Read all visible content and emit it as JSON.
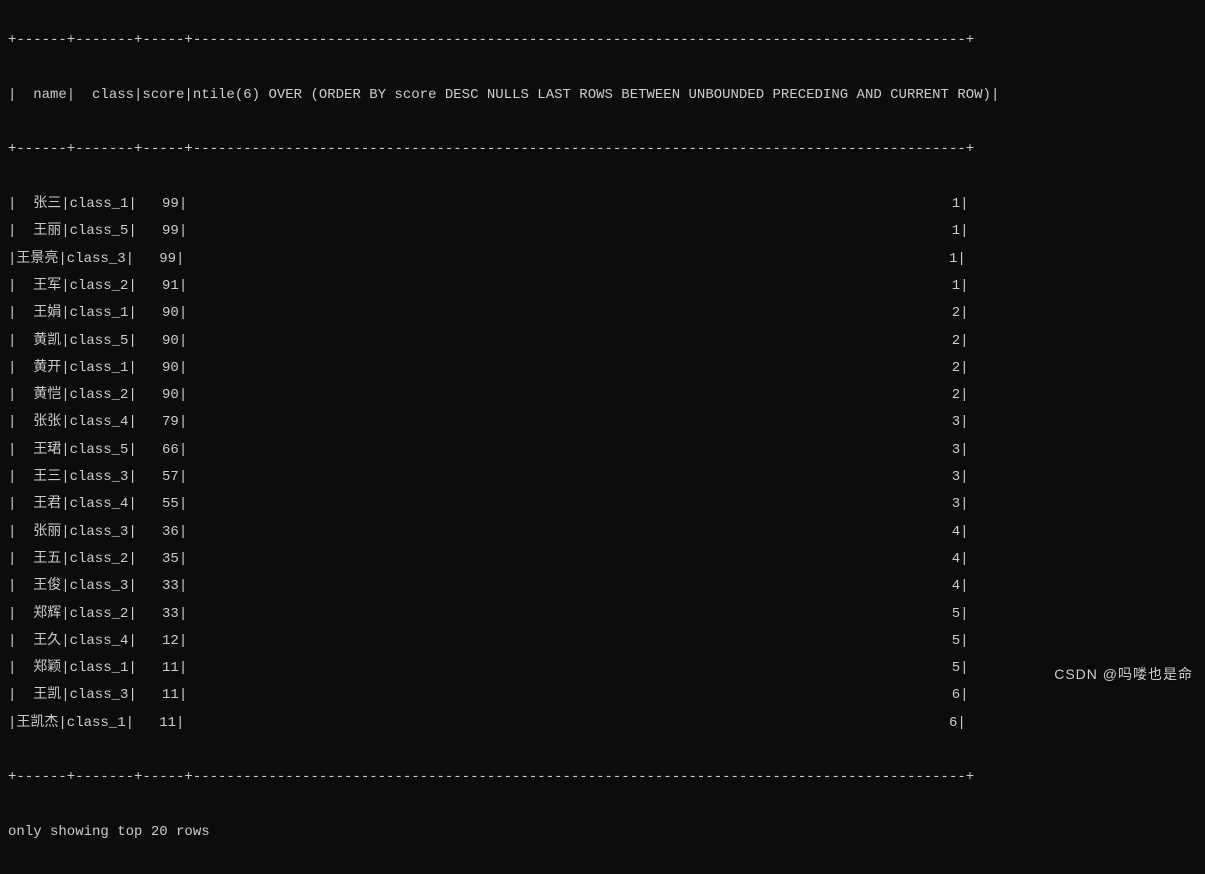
{
  "columns": {
    "name": "name",
    "class": "class",
    "score": "score",
    "ntile": "ntile(6) OVER (ORDER BY score DESC NULLS LAST ROWS BETWEEN UNBOUNDED PRECEDING AND CURRENT ROW)"
  },
  "col_widths": {
    "name": 6,
    "class": 7,
    "score": 5,
    "ntile": 92
  },
  "chart_data": {
    "type": "table",
    "title": "ntile(6) window query result (top 20 rows)",
    "columns": [
      "name",
      "class",
      "score",
      "ntile"
    ],
    "rows": [
      {
        "name": "张三",
        "class": "class_1",
        "score": 99,
        "ntile": 1
      },
      {
        "name": "王丽",
        "class": "class_5",
        "score": 99,
        "ntile": 1
      },
      {
        "name": "王景亮",
        "class": "class_3",
        "score": 99,
        "ntile": 1
      },
      {
        "name": "王军",
        "class": "class_2",
        "score": 91,
        "ntile": 1
      },
      {
        "name": "王娟",
        "class": "class_1",
        "score": 90,
        "ntile": 2
      },
      {
        "name": "黄凯",
        "class": "class_5",
        "score": 90,
        "ntile": 2
      },
      {
        "name": "黄开",
        "class": "class_1",
        "score": 90,
        "ntile": 2
      },
      {
        "name": "黄恺",
        "class": "class_2",
        "score": 90,
        "ntile": 2
      },
      {
        "name": "张张",
        "class": "class_4",
        "score": 79,
        "ntile": 3
      },
      {
        "name": "王珺",
        "class": "class_5",
        "score": 66,
        "ntile": 3
      },
      {
        "name": "王三",
        "class": "class_3",
        "score": 57,
        "ntile": 3
      },
      {
        "name": "王君",
        "class": "class_4",
        "score": 55,
        "ntile": 3
      },
      {
        "name": "张丽",
        "class": "class_3",
        "score": 36,
        "ntile": 4
      },
      {
        "name": "王五",
        "class": "class_2",
        "score": 35,
        "ntile": 4
      },
      {
        "name": "王俊",
        "class": "class_3",
        "score": 33,
        "ntile": 4
      },
      {
        "name": "郑辉",
        "class": "class_2",
        "score": 33,
        "ntile": 5
      },
      {
        "name": "王久",
        "class": "class_4",
        "score": 12,
        "ntile": 5
      },
      {
        "name": "郑颖",
        "class": "class_1",
        "score": 11,
        "ntile": 5
      },
      {
        "name": "王凯",
        "class": "class_3",
        "score": 11,
        "ntile": 6
      },
      {
        "name": "王凯杰",
        "class": "class_1",
        "score": 11,
        "ntile": 6
      }
    ]
  },
  "footer": "only showing top 20 rows",
  "watermark": "CSDN @吗喽也是命"
}
